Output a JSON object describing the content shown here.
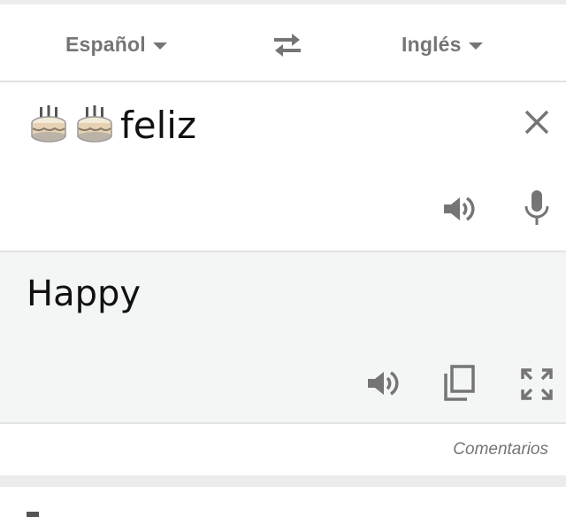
{
  "language_bar": {
    "source_language": "Español",
    "target_language": "Inglés"
  },
  "source": {
    "text": "feliz",
    "emoji_icons": [
      "birthday-cake-icon",
      "birthday-cake-icon"
    ]
  },
  "result": {
    "text": "Happy"
  },
  "footer": {
    "feedback_label": "Comentarios"
  },
  "colors": {
    "icon_grey": "#757575",
    "panel_white": "#ffffff",
    "result_background": "#f4f5f5",
    "page_background": "#ececec"
  }
}
